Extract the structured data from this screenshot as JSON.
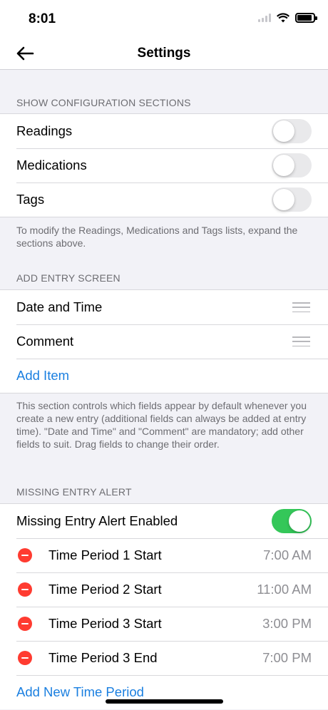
{
  "status_bar": {
    "time": "8:01"
  },
  "nav": {
    "title": "Settings",
    "back_icon": "arrow-left-icon"
  },
  "config_sections": {
    "header": "SHOW CONFIGURATION SECTIONS",
    "items": [
      {
        "label": "Readings",
        "enabled": false
      },
      {
        "label": "Medications",
        "enabled": false
      },
      {
        "label": "Tags",
        "enabled": false
      }
    ],
    "footer": "To modify the Readings, Medications and Tags lists, expand the sections above."
  },
  "add_entry": {
    "header": "ADD ENTRY SCREEN",
    "items": [
      {
        "label": "Date and Time"
      },
      {
        "label": "Comment"
      }
    ],
    "add_item_label": "Add Item",
    "footer": "This section controls which fields appear by default whenever you create a new entry (additional fields can always be added at entry time). \"Date and Time\" and \"Comment\" are mandatory; add other fields to suit. Drag fields to change their order."
  },
  "missing_entry": {
    "header": "MISSING ENTRY ALERT",
    "alert_label": "Missing Entry Alert Enabled",
    "alert_enabled": true,
    "periods": [
      {
        "label": "Time Period 1 Start",
        "time": "7:00 AM"
      },
      {
        "label": "Time Period 2 Start",
        "time": "11:00 AM"
      },
      {
        "label": "Time Period 3 Start",
        "time": "3:00 PM"
      },
      {
        "label": "Time Period 3 End",
        "time": "7:00 PM"
      }
    ],
    "add_period_label": "Add New Time Period"
  },
  "colors": {
    "accent": "#1a7fe0",
    "toggle_on": "#34c759",
    "delete": "#ff3b30"
  }
}
